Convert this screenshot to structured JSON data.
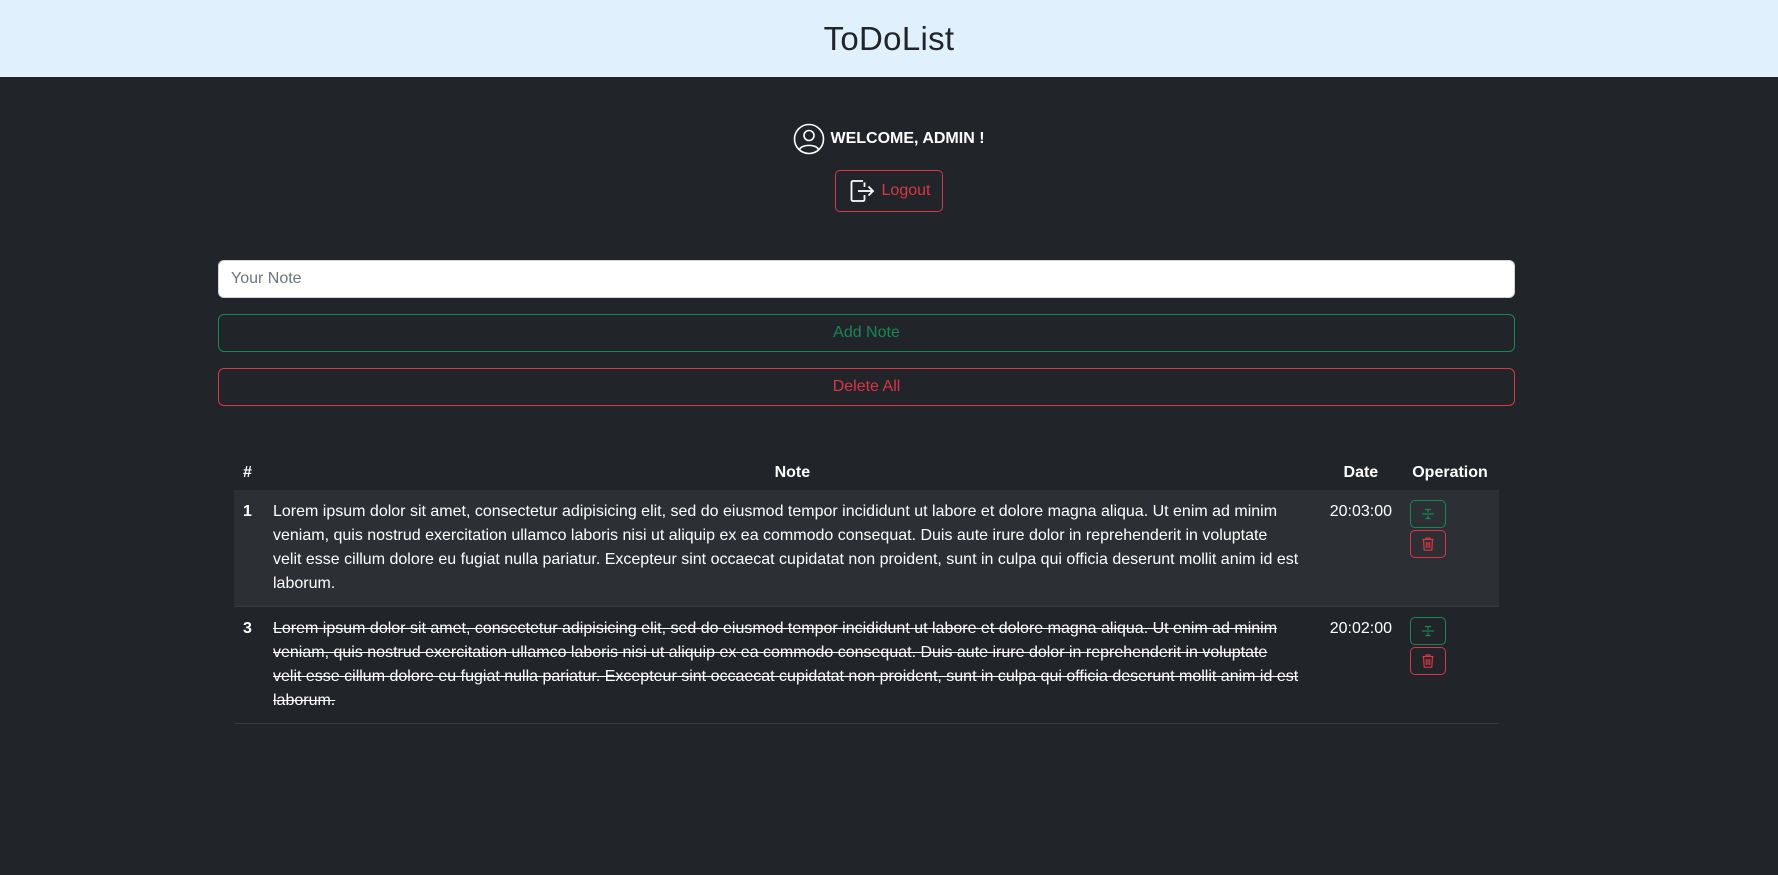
{
  "header": {
    "title": "ToDoList"
  },
  "user": {
    "welcome": "WELCOME, ADMIN !",
    "logout_label": "Logout"
  },
  "form": {
    "note_placeholder": "Your Note",
    "note_value": "",
    "add_label": "Add Note",
    "delete_all_label": "Delete All"
  },
  "table": {
    "headers": [
      "#",
      "Note",
      "Date",
      "Operation"
    ],
    "rows": [
      {
        "num": "1",
        "note": "Lorem ipsum dolor sit amet, consectetur adipisicing elit, sed do eiusmod tempor incididunt ut labore et dolore magna aliqua. Ut enim ad minim veniam, quis nostrud exercitation ullamco laboris nisi ut aliquip ex ea commodo consequat. Duis aute irure dolor in reprehenderit in voluptate velit esse cillum dolore eu fugiat nulla pariatur. Excepteur sint occaecat cupidatat non proident, sunt in culpa qui officia deserunt mollit anim id est laborum.",
        "date": "20:03:00",
        "struck": false
      },
      {
        "num": "3",
        "note": "Lorem ipsum dolor sit amet, consectetur adipisicing elit, sed do eiusmod tempor incididunt ut labore et dolore magna aliqua. Ut enim ad minim veniam, quis nostrud exercitation ullamco laboris nisi ut aliquip ex ea commodo consequat. Duis aute irure dolor in reprehenderit in voluptate velit esse cillum dolore eu fugiat nulla pariatur. Excepteur sint occaecat cupidatat non proident, sunt in culpa qui officia deserunt mollit anim id est laborum.",
        "date": "20:02:00",
        "struck": true
      }
    ]
  },
  "icons": {
    "user": "person-circle-icon",
    "logout": "box-arrow-right-icon",
    "strike": "strikethrough-icon",
    "trash": "trash-icon"
  },
  "colors": {
    "header_bg": "#e1f0fd",
    "page_bg": "#212529",
    "success": "#198754",
    "danger": "#dc3545"
  }
}
